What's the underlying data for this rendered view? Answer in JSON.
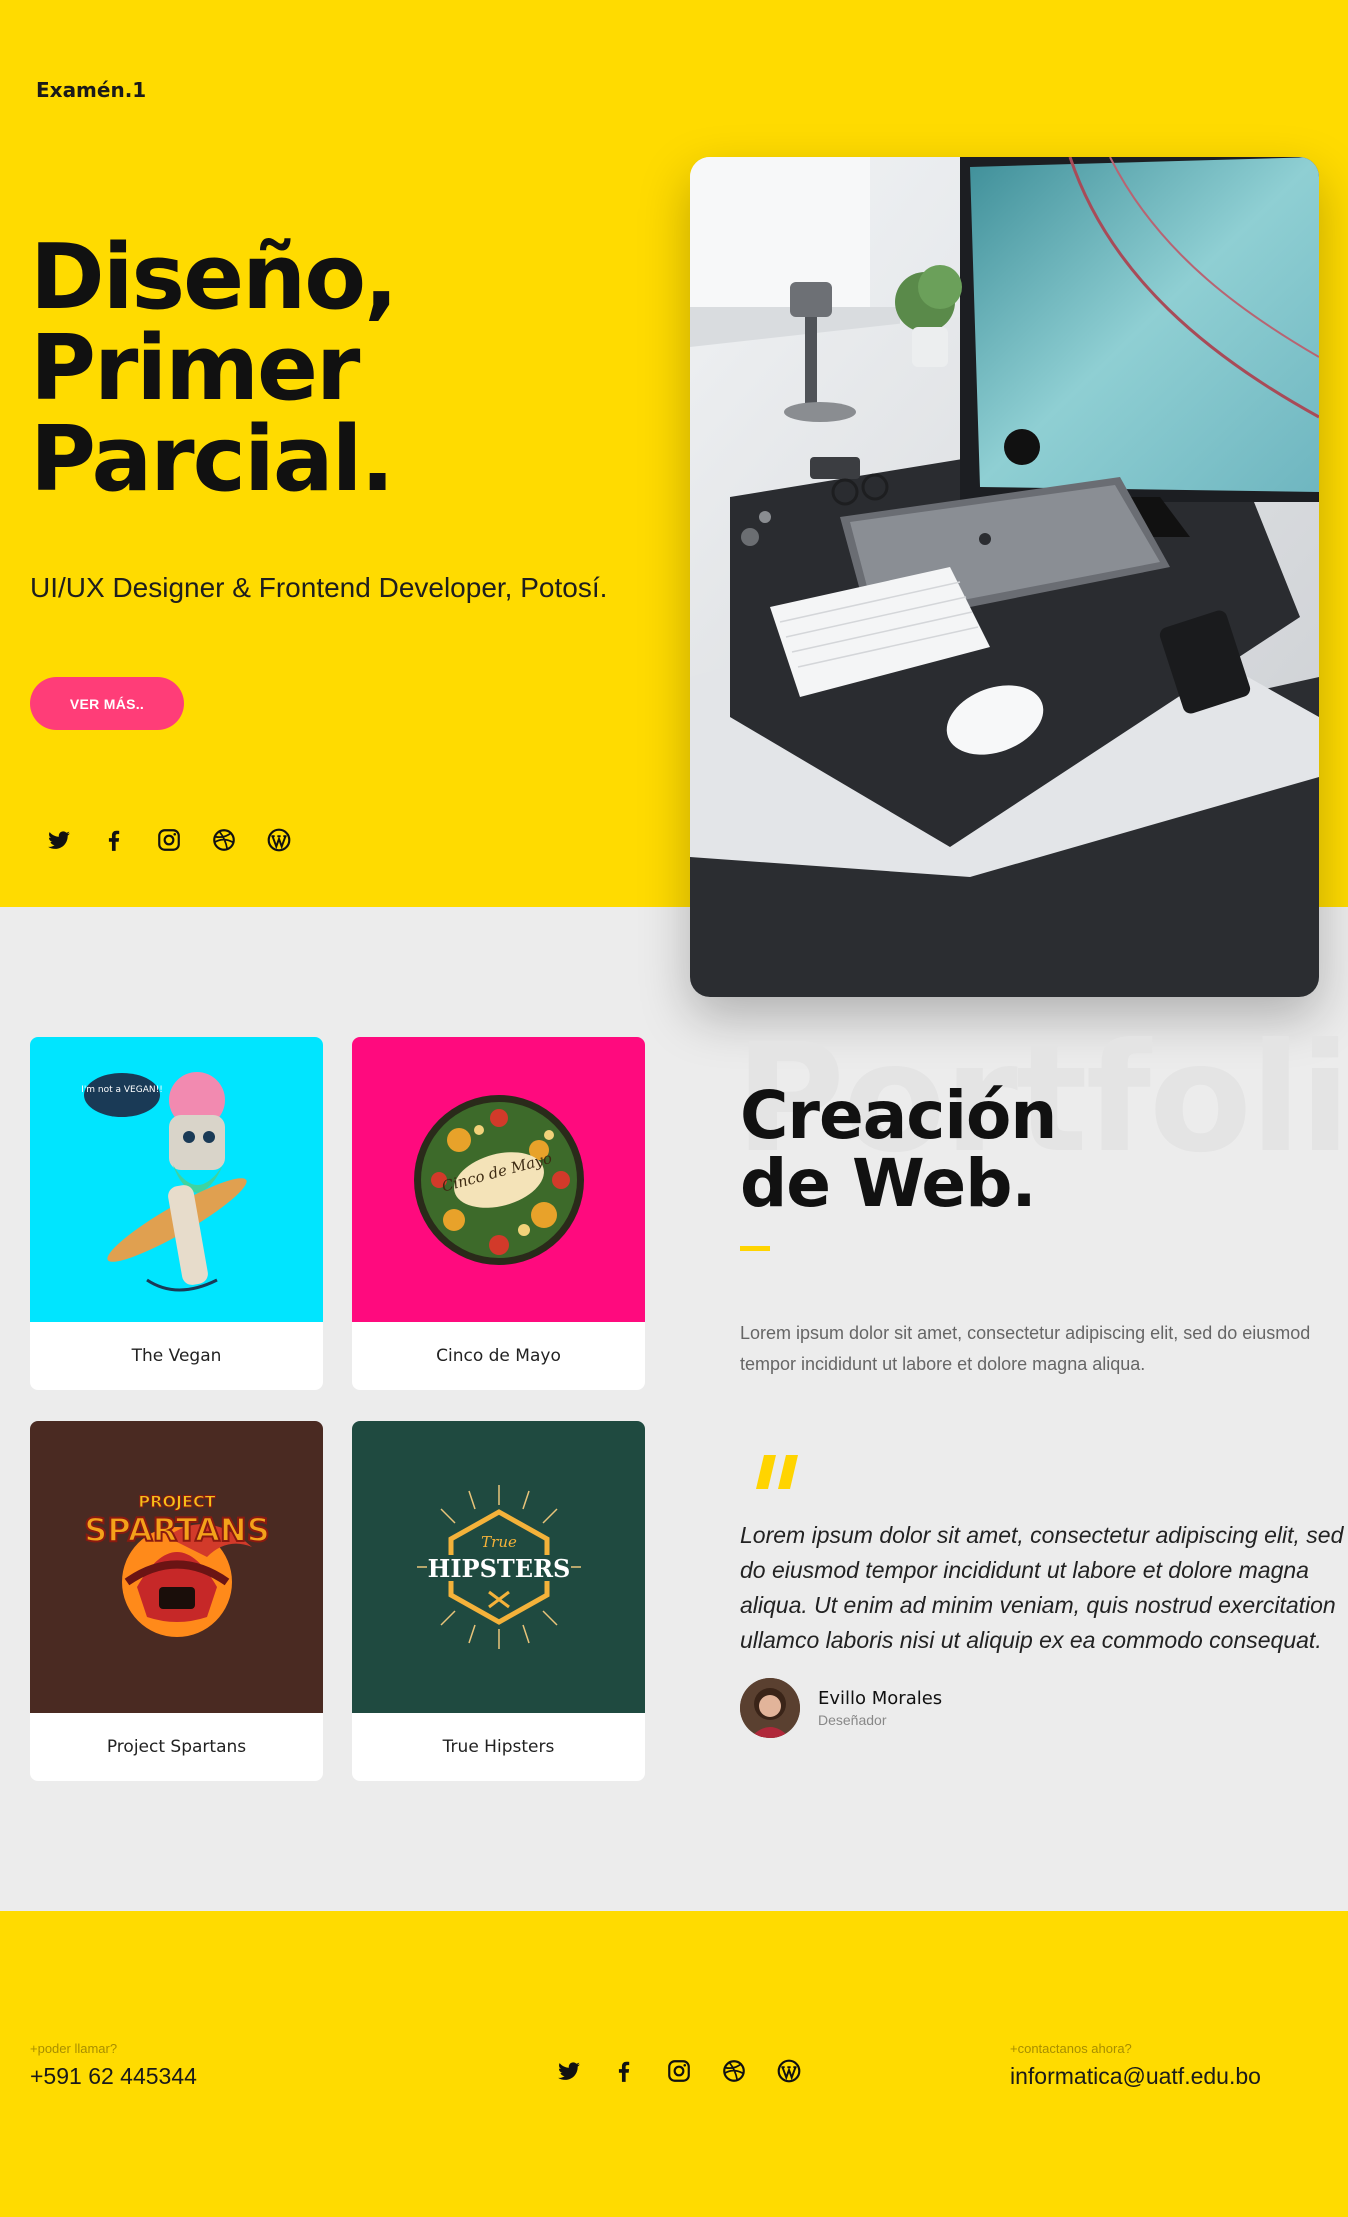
{
  "header": {
    "logo": "Examén.1"
  },
  "hero": {
    "title_lines": [
      "Diseño,",
      "Primer",
      "Parcial."
    ],
    "subtitle": "UI/UX Designer & Frontend Developer, Potosí.",
    "cta_label": "VER MÁS..",
    "socials": [
      "twitter-icon",
      "facebook-icon",
      "instagram-icon",
      "dribbble-icon",
      "wordpress-icon"
    ]
  },
  "portfolio": {
    "watermark": "Portfolio",
    "title_lines": [
      "Creación",
      "de Web."
    ],
    "description": "Lorem ipsum dolor sit amet, consectetur adipiscing elit, sed do eiusmod tempor incididunt ut labore et dolore magna aliqua.",
    "items": [
      {
        "label": "The Vegan",
        "color": "#00e5ff"
      },
      {
        "label": "Cinco de Mayo",
        "color": "#ff0a7e"
      },
      {
        "label": "Project Spartans",
        "color": "#4a2a22"
      },
      {
        "label": "True Hipsters",
        "color": "#1f4a40"
      }
    ],
    "art_text": {
      "vegan_bubble": "I'm not a VEGAN!!",
      "cinco_badge": "Cinco de Mayo",
      "spartans_top": "PROJECT",
      "spartans_main": "SPARTANS",
      "hipsters_script": "True",
      "hipsters_main": "HIPSTERS"
    },
    "quote": "Lorem ipsum dolor sit amet, consectetur adipiscing elit, sed do eiusmod tempor incididunt ut labore et dolore magna aliqua. Ut enim ad minim veniam, quis nostrud exercitation ullamco laboris nisi ut aliquip ex ea commodo consequat.",
    "author": {
      "name": "Evillo Morales",
      "role": "Deseñador"
    }
  },
  "footer": {
    "call_label": "+poder llamar?",
    "phone": "+591 62 445344",
    "contact_label": "+contactanos ahora?",
    "email": "informatica@uatf.edu.bo",
    "socials": [
      "twitter-icon",
      "facebook-icon",
      "instagram-icon",
      "dribbble-icon",
      "wordpress-icon"
    ]
  },
  "colors": {
    "brand_yellow": "#ffdb00",
    "cta_pink": "#ff3d78",
    "background": "#ececec"
  }
}
